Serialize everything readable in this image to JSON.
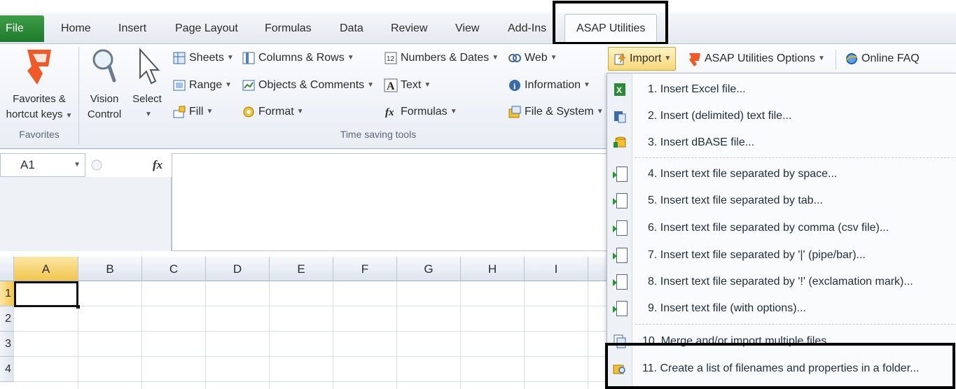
{
  "tabs": {
    "file": "File",
    "items": [
      "Home",
      "Insert",
      "Page Layout",
      "Formulas",
      "Data",
      "Review",
      "View",
      "Add-Ins"
    ],
    "active": "ASAP Utilities"
  },
  "ribbon": {
    "favorites": {
      "label_line1": "Favorites &",
      "label_line2": "hortcut keys",
      "group": "Favorites"
    },
    "vision": {
      "line1": "Vision",
      "line2": "Control"
    },
    "select": {
      "label": "Select"
    },
    "sheets": "Sheets",
    "range": "Range",
    "fill": "Fill",
    "columns_rows": "Columns & Rows",
    "objects_comments": "Objects & Comments",
    "format": "Format",
    "numbers_dates": "Numbers & Dates",
    "text": "Text",
    "formulas": "Formulas",
    "web": "Web",
    "information": "Information",
    "file_system": "File & System",
    "group_time_saving": "Time saving tools",
    "import": "Import",
    "asap_options": "ASAP Utilities Options",
    "online_faq": "Online FAQ"
  },
  "formula_bar": {
    "name_box": "A1",
    "fx": "fx"
  },
  "grid": {
    "columns": [
      "A",
      "B",
      "C",
      "D",
      "E",
      "F",
      "G",
      "H",
      "I"
    ],
    "rows": [
      "1",
      "2",
      "3",
      "4"
    ]
  },
  "import_menu": {
    "items": [
      "1. Insert Excel file...",
      "2. Insert (delimited) text file...",
      "3. Insert dBASE file...",
      "4. Insert text file separated by space...",
      "5. Insert text file separated by tab...",
      "6. Insert text file separated by comma (csv file)...",
      "7. Insert text file separated by '|' (pipe/bar)...",
      "8. Insert text file separated by '!' (exclamation mark)...",
      "9. Insert text file (with options)...",
      "10. Merge and/or import multiple files...",
      "11. Create a list of filenames and properties in a folder..."
    ]
  },
  "colors": {
    "file_tab": "#2a8a37",
    "highlight_border": "#000000",
    "selected_header": "#f3c64e"
  }
}
